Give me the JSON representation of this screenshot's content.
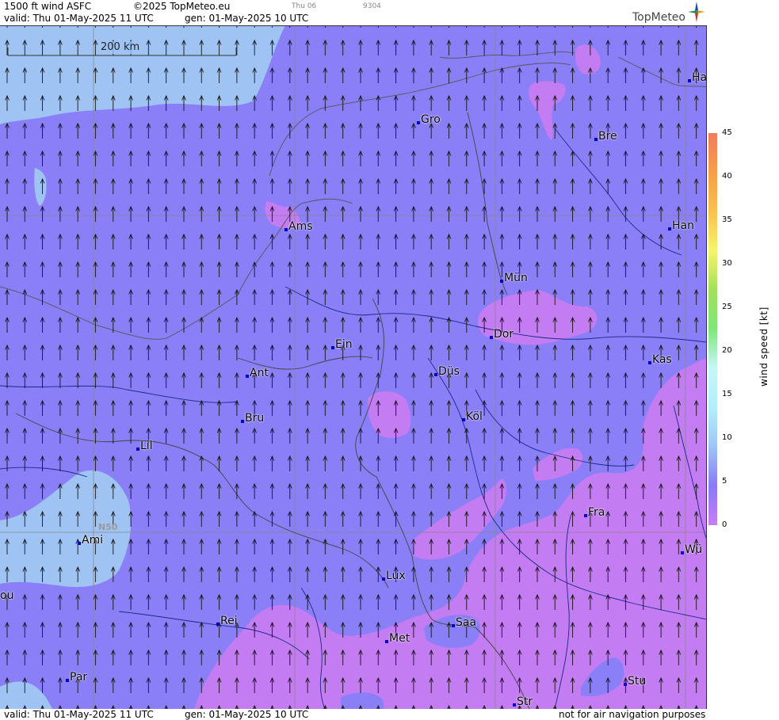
{
  "header": {
    "product": "1500 ft wind ASFC",
    "copyright": "©2025 TopMeteo.eu",
    "valid": "valid:  Thu  01-May-2025  11 UTC",
    "gen": "gen: 01-May-2025 10 UTC",
    "faint1": "Thu 06",
    "faint2": "9304",
    "logo": "TopMeteo"
  },
  "footer": {
    "valid": "valid:  Thu  01-May-2025  11 UTC",
    "gen": "gen: 01-May-2025 10 UTC",
    "disclaimer": "not for air navigation purposes"
  },
  "scale_bar": {
    "label": "200 km"
  },
  "grid_labels": {
    "lat": "N50"
  },
  "cities": [
    {
      "name": "Gro"
    },
    {
      "name": "Bre"
    },
    {
      "name": "Ha"
    },
    {
      "name": "Ams"
    },
    {
      "name": "Han"
    },
    {
      "name": "Mün"
    },
    {
      "name": "Dor"
    },
    {
      "name": "Ein"
    },
    {
      "name": "Kas"
    },
    {
      "name": "Ant"
    },
    {
      "name": "Düs"
    },
    {
      "name": "Köl"
    },
    {
      "name": "Bru"
    },
    {
      "name": "Lil"
    },
    {
      "name": "Ami"
    },
    {
      "name": "Fra"
    },
    {
      "name": "Wü"
    },
    {
      "name": "ou"
    },
    {
      "name": "Lux"
    },
    {
      "name": "Rei"
    },
    {
      "name": "Saa"
    },
    {
      "name": "Met"
    },
    {
      "name": "Par"
    },
    {
      "name": "Stu"
    },
    {
      "name": "Str"
    }
  ],
  "colorbar": {
    "title": "wind  speed  [kt]",
    "ticks": [
      "45",
      "40",
      "35",
      "30",
      "25",
      "20",
      "15",
      "10",
      "5",
      "0"
    ],
    "colors": [
      "#c77ef5",
      "#8a79f8",
      "#9ec5f6",
      "#b3eefa",
      "#c6f7f7",
      "#7fe67a",
      "#a2e05a",
      "#f6f56a",
      "#f9c14e",
      "#f79d4a",
      "#f37b5e"
    ]
  },
  "colors": {
    "calm": "#c47cf2",
    "light": "#8b7ff8",
    "moderate": "#9fc4f4"
  }
}
